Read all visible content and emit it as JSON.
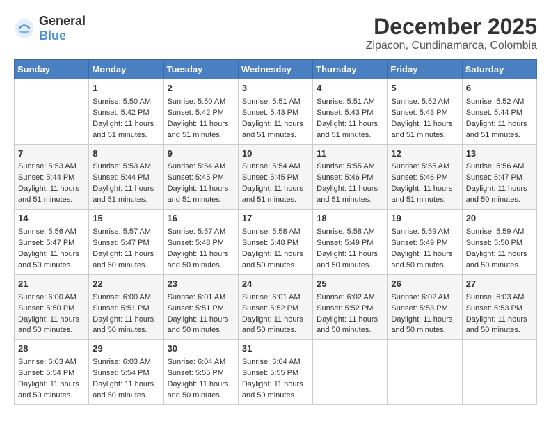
{
  "header": {
    "logo_general": "General",
    "logo_blue": "Blue",
    "month_title": "December 2025",
    "location": "Zipacon, Cundinamarca, Colombia"
  },
  "weekdays": [
    "Sunday",
    "Monday",
    "Tuesday",
    "Wednesday",
    "Thursday",
    "Friday",
    "Saturday"
  ],
  "weeks": [
    [
      {
        "day": "",
        "info": ""
      },
      {
        "day": "1",
        "info": "Sunrise: 5:50 AM\nSunset: 5:42 PM\nDaylight: 11 hours\nand 51 minutes."
      },
      {
        "day": "2",
        "info": "Sunrise: 5:50 AM\nSunset: 5:42 PM\nDaylight: 11 hours\nand 51 minutes."
      },
      {
        "day": "3",
        "info": "Sunrise: 5:51 AM\nSunset: 5:43 PM\nDaylight: 11 hours\nand 51 minutes."
      },
      {
        "day": "4",
        "info": "Sunrise: 5:51 AM\nSunset: 5:43 PM\nDaylight: 11 hours\nand 51 minutes."
      },
      {
        "day": "5",
        "info": "Sunrise: 5:52 AM\nSunset: 5:43 PM\nDaylight: 11 hours\nand 51 minutes."
      },
      {
        "day": "6",
        "info": "Sunrise: 5:52 AM\nSunset: 5:44 PM\nDaylight: 11 hours\nand 51 minutes."
      }
    ],
    [
      {
        "day": "7",
        "info": "Sunrise: 5:53 AM\nSunset: 5:44 PM\nDaylight: 11 hours\nand 51 minutes."
      },
      {
        "day": "8",
        "info": "Sunrise: 5:53 AM\nSunset: 5:44 PM\nDaylight: 11 hours\nand 51 minutes."
      },
      {
        "day": "9",
        "info": "Sunrise: 5:54 AM\nSunset: 5:45 PM\nDaylight: 11 hours\nand 51 minutes."
      },
      {
        "day": "10",
        "info": "Sunrise: 5:54 AM\nSunset: 5:45 PM\nDaylight: 11 hours\nand 51 minutes."
      },
      {
        "day": "11",
        "info": "Sunrise: 5:55 AM\nSunset: 5:46 PM\nDaylight: 11 hours\nand 51 minutes."
      },
      {
        "day": "12",
        "info": "Sunrise: 5:55 AM\nSunset: 5:46 PM\nDaylight: 11 hours\nand 51 minutes."
      },
      {
        "day": "13",
        "info": "Sunrise: 5:56 AM\nSunset: 5:47 PM\nDaylight: 11 hours\nand 50 minutes."
      }
    ],
    [
      {
        "day": "14",
        "info": "Sunrise: 5:56 AM\nSunset: 5:47 PM\nDaylight: 11 hours\nand 50 minutes."
      },
      {
        "day": "15",
        "info": "Sunrise: 5:57 AM\nSunset: 5:47 PM\nDaylight: 11 hours\nand 50 minutes."
      },
      {
        "day": "16",
        "info": "Sunrise: 5:57 AM\nSunset: 5:48 PM\nDaylight: 11 hours\nand 50 minutes."
      },
      {
        "day": "17",
        "info": "Sunrise: 5:58 AM\nSunset: 5:48 PM\nDaylight: 11 hours\nand 50 minutes."
      },
      {
        "day": "18",
        "info": "Sunrise: 5:58 AM\nSunset: 5:49 PM\nDaylight: 11 hours\nand 50 minutes."
      },
      {
        "day": "19",
        "info": "Sunrise: 5:59 AM\nSunset: 5:49 PM\nDaylight: 11 hours\nand 50 minutes."
      },
      {
        "day": "20",
        "info": "Sunrise: 5:59 AM\nSunset: 5:50 PM\nDaylight: 11 hours\nand 50 minutes."
      }
    ],
    [
      {
        "day": "21",
        "info": "Sunrise: 6:00 AM\nSunset: 5:50 PM\nDaylight: 11 hours\nand 50 minutes."
      },
      {
        "day": "22",
        "info": "Sunrise: 6:00 AM\nSunset: 5:51 PM\nDaylight: 11 hours\nand 50 minutes."
      },
      {
        "day": "23",
        "info": "Sunrise: 6:01 AM\nSunset: 5:51 PM\nDaylight: 11 hours\nand 50 minutes."
      },
      {
        "day": "24",
        "info": "Sunrise: 6:01 AM\nSunset: 5:52 PM\nDaylight: 11 hours\nand 50 minutes."
      },
      {
        "day": "25",
        "info": "Sunrise: 6:02 AM\nSunset: 5:52 PM\nDaylight: 11 hours\nand 50 minutes."
      },
      {
        "day": "26",
        "info": "Sunrise: 6:02 AM\nSunset: 5:53 PM\nDaylight: 11 hours\nand 50 minutes."
      },
      {
        "day": "27",
        "info": "Sunrise: 6:03 AM\nSunset: 5:53 PM\nDaylight: 11 hours\nand 50 minutes."
      }
    ],
    [
      {
        "day": "28",
        "info": "Sunrise: 6:03 AM\nSunset: 5:54 PM\nDaylight: 11 hours\nand 50 minutes."
      },
      {
        "day": "29",
        "info": "Sunrise: 6:03 AM\nSunset: 5:54 PM\nDaylight: 11 hours\nand 50 minutes."
      },
      {
        "day": "30",
        "info": "Sunrise: 6:04 AM\nSunset: 5:55 PM\nDaylight: 11 hours\nand 50 minutes."
      },
      {
        "day": "31",
        "info": "Sunrise: 6:04 AM\nSunset: 5:55 PM\nDaylight: 11 hours\nand 50 minutes."
      },
      {
        "day": "",
        "info": ""
      },
      {
        "day": "",
        "info": ""
      },
      {
        "day": "",
        "info": ""
      }
    ]
  ]
}
